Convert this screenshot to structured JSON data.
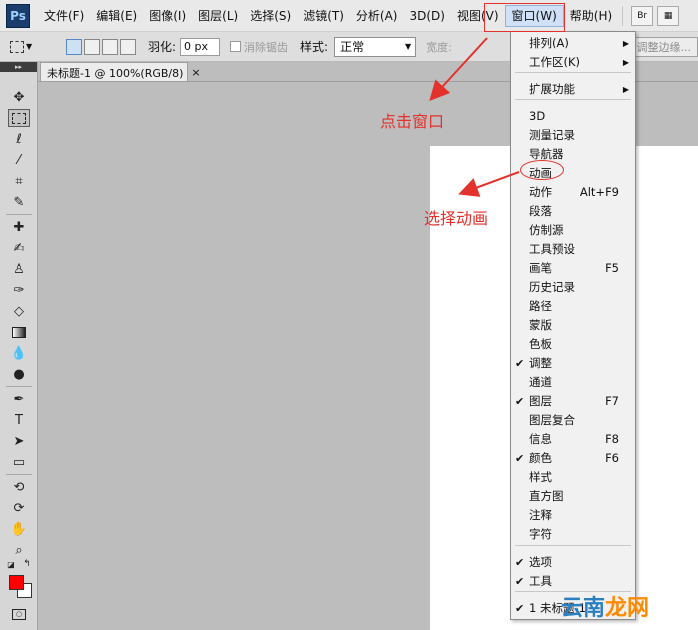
{
  "app": {
    "logo_text": "Ps"
  },
  "menubar": {
    "items": [
      {
        "label": "文件(F)"
      },
      {
        "label": "编辑(E)"
      },
      {
        "label": "图像(I)"
      },
      {
        "label": "图层(L)"
      },
      {
        "label": "选择(S)"
      },
      {
        "label": "滤镜(T)"
      },
      {
        "label": "分析(A)"
      },
      {
        "label": "3D(D)"
      },
      {
        "label": "视图(V)"
      },
      {
        "label": "窗口(W)"
      },
      {
        "label": "帮助(H)"
      }
    ],
    "active": "窗口(W)",
    "bridge_label": "Br"
  },
  "options": {
    "feather_label": "羽化:",
    "feather_value": "0 px",
    "antialias_label": "消除锯齿",
    "style_label": "样式:",
    "style_value": "正常",
    "width_label": "宽度:",
    "refine_edge_label": "调整边缘..."
  },
  "document": {
    "tab_label": "未标题-1 @ 100%(RGB/8)",
    "close_glyph": "×"
  },
  "window_menu": {
    "items": [
      {
        "label": "排列(A)",
        "submenu": true
      },
      {
        "label": "工作区(K)",
        "submenu": true
      },
      {
        "label": "扩展功能",
        "submenu": true
      },
      {
        "label": "3D"
      },
      {
        "label": "测量记录"
      },
      {
        "label": "导航器"
      },
      {
        "label": "动画"
      },
      {
        "label": "动作",
        "shortcut": "Alt+F9"
      },
      {
        "label": "段落"
      },
      {
        "label": "仿制源"
      },
      {
        "label": "工具预设"
      },
      {
        "label": "画笔",
        "shortcut": "F5"
      },
      {
        "label": "历史记录"
      },
      {
        "label": "路径"
      },
      {
        "label": "蒙版"
      },
      {
        "label": "色板"
      },
      {
        "label": "调整",
        "checked": true
      },
      {
        "label": "通道"
      },
      {
        "label": "图层",
        "checked": true,
        "shortcut": "F7"
      },
      {
        "label": "图层复合"
      },
      {
        "label": "信息",
        "shortcut": "F8"
      },
      {
        "label": "颜色",
        "checked": true,
        "shortcut": "F6"
      },
      {
        "label": "样式"
      },
      {
        "label": "直方图"
      },
      {
        "label": "注释"
      },
      {
        "label": "字符"
      },
      {
        "label": "选项",
        "checked": true
      },
      {
        "label": "工具",
        "checked": true
      },
      {
        "label": "1 未标题-1",
        "checked": true
      }
    ],
    "check_glyph": "✔",
    "submenu_glyph": "▶"
  },
  "annotations": {
    "click_window": "点击窗口",
    "select_animation": "选择动画",
    "color": "#e3312c"
  },
  "colors": {
    "foreground": "#ff0000",
    "background": "#ffffff"
  },
  "watermark": {
    "part1": "云南",
    "part2": "龙网"
  }
}
